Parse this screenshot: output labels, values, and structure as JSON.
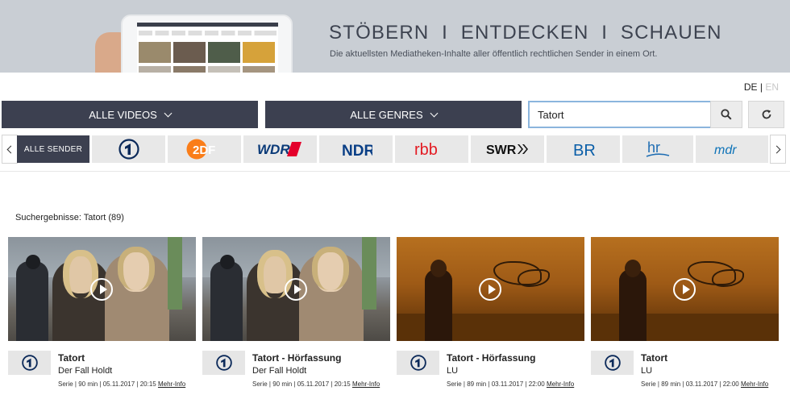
{
  "banner": {
    "title": "STÖBERN  I  ENTDECKEN  I  SCHAUEN",
    "subtitle": "Die aktuellsten Mediatheken-Inhalte aller öffentlich rechtlichen Sender in einem Ort."
  },
  "language": {
    "de": "DE",
    "separator": "|",
    "en": "EN"
  },
  "filters": {
    "videos": "ALLE VIDEOS",
    "genres": "ALLE GENRES"
  },
  "search": {
    "value": "Tatort"
  },
  "channels": {
    "all": "ALLE SENDER",
    "items": [
      "Das Erste",
      "ZDF",
      "WDR",
      "NDR",
      "rbb",
      "SWR",
      "BR",
      "hr",
      "mdr"
    ],
    "labels": {
      "zdf": "2DF",
      "wdr": "WDR",
      "ndr": "NDR",
      "rbb": "rbb",
      "swr": "SWR",
      "br": "BR",
      "hr": "hr",
      "mdr": "mdr"
    }
  },
  "results": {
    "label": "Suchergebnisse: Tatort (89)",
    "more": "Mehr-Info",
    "cards": [
      {
        "title": "Tatort",
        "subtitle": "Der Fall Holdt",
        "meta": "Serie | 90 min | 05.11.2017 | 20:15",
        "channel": "Das Erste"
      },
      {
        "title": "Tatort - Hörfassung",
        "subtitle": "Der Fall Holdt",
        "meta": "Serie | 90 min | 05.11.2017 | 20:15",
        "channel": "Das Erste"
      },
      {
        "title": "Tatort - Hörfassung",
        "subtitle": "LU",
        "meta": "Serie | 89 min | 03.11.2017 | 22:00",
        "channel": "Das Erste"
      },
      {
        "title": "Tatort",
        "subtitle": "LU",
        "meta": "Serie | 89 min | 03.11.2017 | 22:00",
        "channel": "Das Erste"
      }
    ]
  },
  "colors": {
    "dark": "#3c4050",
    "banner": "#c9ced4",
    "wdr_red": "#e4002b",
    "zdf_orange": "#fa7d19",
    "br_blue": "#0a5ea8",
    "mdr_blue": "#0e73b8"
  }
}
